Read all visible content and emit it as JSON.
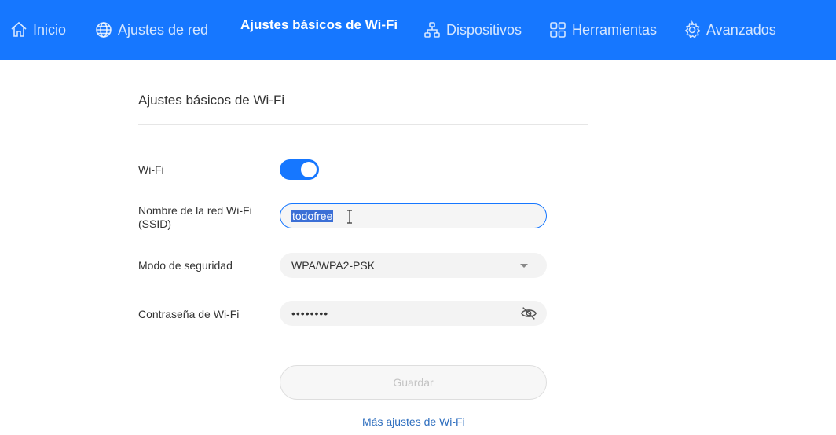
{
  "nav": {
    "items": [
      {
        "label": "Inicio",
        "icon": "home-icon"
      },
      {
        "label": "Ajustes de red",
        "icon": "globe-icon"
      },
      {
        "label": "Ajustes básicos de Wi-Fi",
        "icon": ""
      },
      {
        "label": "Dispositivos",
        "icon": "devices-icon"
      },
      {
        "label": "Herramientas",
        "icon": "grid-icon"
      },
      {
        "label": "Avanzados",
        "icon": "gear-icon"
      }
    ],
    "active": "Ajustes básicos de Wi-Fi",
    "bar_color": "#1677ff"
  },
  "card": {
    "title": "Ajustes básicos de Wi-Fi"
  },
  "form": {
    "wifi": {
      "label": "Wi-Fi",
      "enabled": true
    },
    "ssid": {
      "label_line1": "Nombre de la red Wi-Fi",
      "label_line2": "(SSID)",
      "value": "todofree"
    },
    "security": {
      "label": "Modo de seguridad",
      "value": "WPA/WPA2-PSK"
    },
    "password": {
      "label": "Contraseña de Wi-Fi",
      "value": "••••••••"
    },
    "save_label": "Guardar",
    "more_link": "Más ajustes de Wi-Fi"
  }
}
